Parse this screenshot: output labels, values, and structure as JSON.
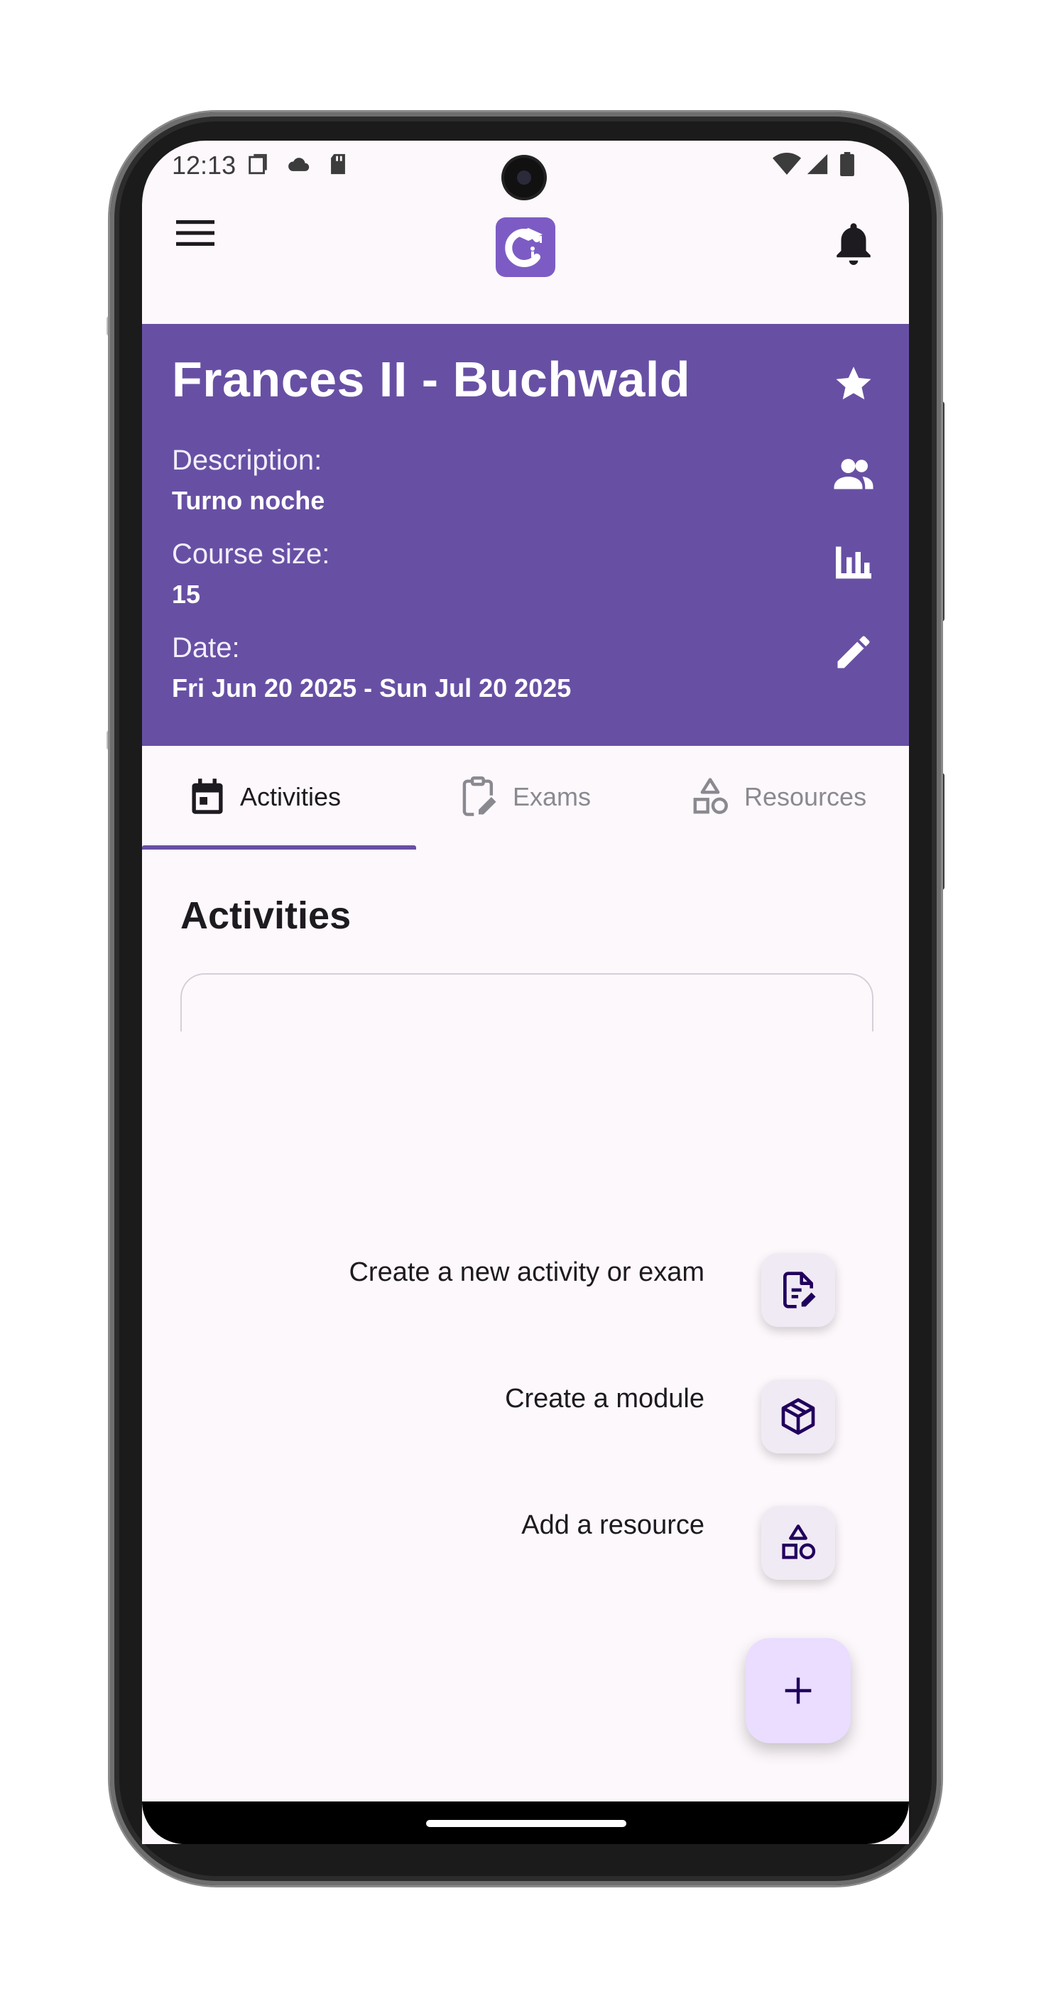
{
  "status_bar": {
    "time": "12:13",
    "icons": [
      "screen-icon",
      "cloud-icon",
      "sd-card-icon",
      "wifi-icon",
      "signal-icon",
      "battery-icon"
    ]
  },
  "app_bar": {
    "menu_icon": "menu-icon",
    "logo": "app-logo",
    "notifications_icon": "bell-icon"
  },
  "course": {
    "title": "Frances II - Buchwald",
    "description_label": "Description:",
    "description_value": "Turno noche",
    "size_label": "Course size:",
    "size_value": "15",
    "date_label": "Date:",
    "date_value": "Fri Jun 20 2025 - Sun Jul 20 2025",
    "actions": [
      "star-icon",
      "people-icon",
      "bar-chart-icon",
      "edit-icon"
    ]
  },
  "tabs": [
    {
      "label": "Activities",
      "icon": "calendar-icon",
      "active": true
    },
    {
      "label": "Exams",
      "icon": "clipboard-edit-icon",
      "active": false
    },
    {
      "label": "Resources",
      "icon": "shapes-icon",
      "active": false
    }
  ],
  "main": {
    "section_title": "Activities"
  },
  "speed_dial": {
    "items": [
      {
        "label": "Create a new activity or exam",
        "icon": "document-edit-icon"
      },
      {
        "label": "Create a module",
        "icon": "cube-icon"
      },
      {
        "label": "Add a resource",
        "icon": "shapes-icon"
      }
    ],
    "fab_icon": "plus-icon"
  },
  "colors": {
    "primary": "#6750a4",
    "background": "#fdf8fc",
    "fab": "#eaddff",
    "speed_dial_button": "#f0eaf4"
  }
}
